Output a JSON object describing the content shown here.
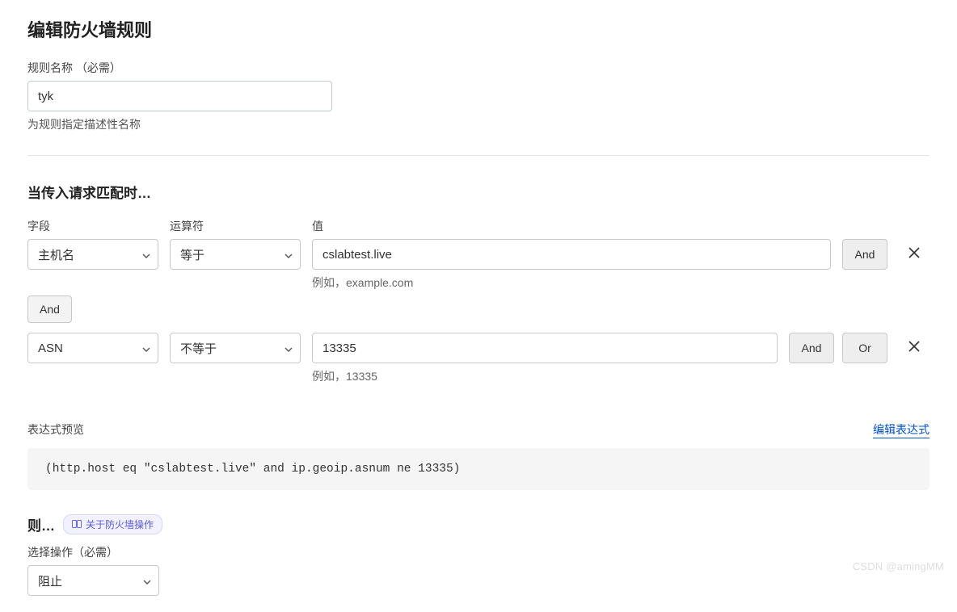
{
  "page_title": "编辑防火墙规则",
  "rule_name": {
    "label": "规则名称 （必需）",
    "value": "tyk",
    "help": "为规则指定描述性名称"
  },
  "match_section": {
    "title": "当传入请求匹配时…",
    "columns": {
      "field": "字段",
      "operator": "运算符",
      "value": "值"
    },
    "rows": [
      {
        "field": "主机名",
        "operator": "等于",
        "value": "cslabtest.live",
        "example": "例如，example.com",
        "logic": [
          "And"
        ]
      },
      {
        "field": "ASN",
        "operator": "不等于",
        "value": "13335",
        "example": "例如，13335",
        "logic": [
          "And",
          "Or"
        ]
      }
    ],
    "connector": "And"
  },
  "preview": {
    "label": "表达式预览",
    "edit_link": "编辑表达式",
    "expression": "(http.host eq \"cslabtest.live\" and ip.geoip.asnum ne 13335)"
  },
  "then_section": {
    "label": "则…",
    "about_badge": "关于防火墙操作",
    "action_label": "选择操作（必需）",
    "action_value": "阻止"
  },
  "watermark": "CSDN @amingMM"
}
